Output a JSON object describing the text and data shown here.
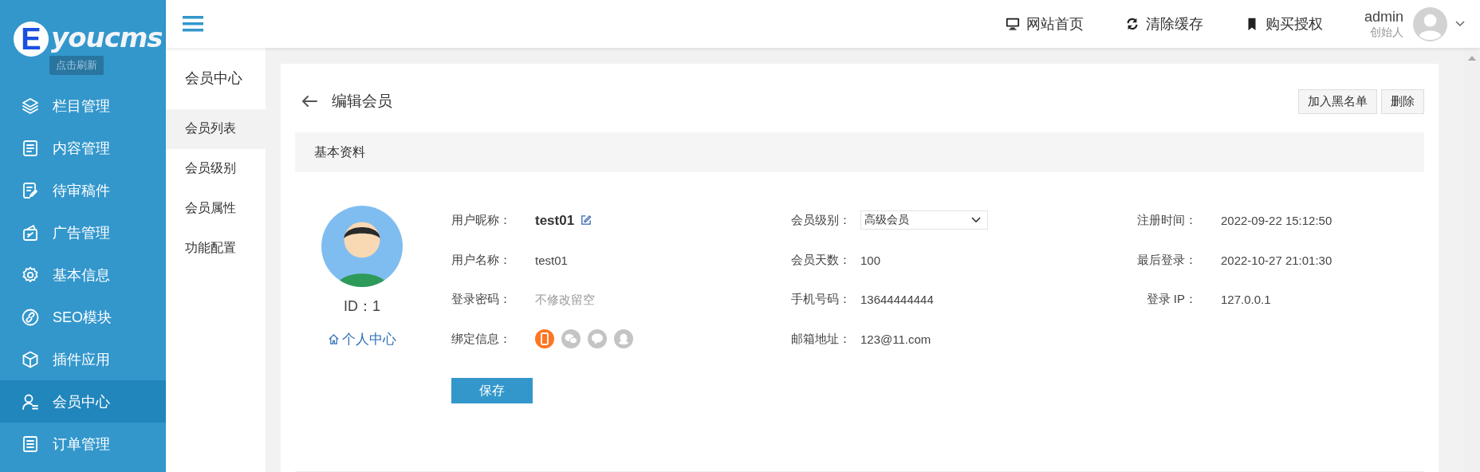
{
  "logo": {
    "mark": "E",
    "text": "youcms",
    "tooltip": "点击刷新"
  },
  "sidebar": {
    "items": [
      {
        "label": "栏目管理",
        "selected": false
      },
      {
        "label": "内容管理",
        "selected": false
      },
      {
        "label": "待审稿件",
        "selected": false
      },
      {
        "label": "广告管理",
        "selected": false
      },
      {
        "label": "基本信息",
        "selected": false
      },
      {
        "label": "SEO模块",
        "selected": false
      },
      {
        "label": "插件应用",
        "selected": false
      },
      {
        "label": "会员中心",
        "selected": true
      },
      {
        "label": "订单管理",
        "selected": false
      }
    ]
  },
  "topbar": {
    "links": [
      {
        "label": "网站首页"
      },
      {
        "label": "清除缓存"
      },
      {
        "label": "购买授权"
      }
    ],
    "user": {
      "name": "admin",
      "role": "创始人"
    }
  },
  "submenu": {
    "title": "会员中心",
    "items": [
      {
        "label": "会员列表",
        "selected": true
      },
      {
        "label": "会员级别",
        "selected": false
      },
      {
        "label": "会员属性",
        "selected": false
      },
      {
        "label": "功能配置",
        "selected": false
      }
    ]
  },
  "page": {
    "title": "编辑会员",
    "actions": [
      "加入黑名单",
      "删除"
    ],
    "section": "基本资料",
    "profile": {
      "id": "ID：1",
      "link": "个人中心"
    },
    "columns": [
      [
        {
          "label": "用户昵称：",
          "kind": "nickname",
          "value": "test01"
        },
        {
          "label": "用户名称：",
          "kind": "text",
          "value": "test01"
        },
        {
          "label": "登录密码：",
          "kind": "password",
          "placeholder": "不修改留空"
        },
        {
          "label": "绑定信息：",
          "kind": "bindings",
          "items": [
            {
              "kind": "mobile",
              "bound": true
            },
            {
              "kind": "wechat",
              "bound": false
            },
            {
              "kind": "chat",
              "bound": false
            },
            {
              "kind": "qq",
              "bound": false
            }
          ]
        }
      ],
      [
        {
          "label": "会员级别：",
          "kind": "select",
          "value": "高级会员"
        },
        {
          "label": "会员天数：",
          "kind": "text",
          "value": "100"
        },
        {
          "label": "手机号码：",
          "kind": "text",
          "value": "13644444444"
        },
        {
          "label": "邮箱地址：",
          "kind": "text",
          "value": "123@11.com"
        }
      ],
      [
        {
          "label": "注册时间：",
          "kind": "text",
          "value": "2022-09-22 15:12:50"
        },
        {
          "label": "最后登录：",
          "kind": "text",
          "value": "2022-10-27 21:01:30"
        },
        {
          "label": "登录 IP：",
          "kind": "text",
          "value": "127.0.0.1"
        }
      ]
    ],
    "save": "保存"
  }
}
